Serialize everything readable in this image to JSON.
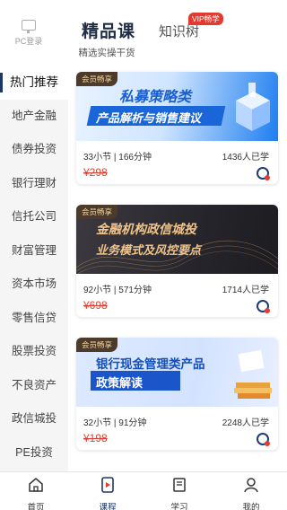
{
  "header": {
    "pc_login": "PC登录",
    "tab_main": {
      "title": "精品课",
      "subtitle": "精选实操干货"
    },
    "tab_knowledge": {
      "title": "知识树",
      "badge": "VIP畅学"
    }
  },
  "sidebar": {
    "items": [
      {
        "label": "热门推荐",
        "active": true
      },
      {
        "label": "地产金融"
      },
      {
        "label": "债券投资"
      },
      {
        "label": "银行理财"
      },
      {
        "label": "信托公司"
      },
      {
        "label": "财富管理"
      },
      {
        "label": "资本市场"
      },
      {
        "label": "零售信贷"
      },
      {
        "label": "股票投资"
      },
      {
        "label": "不良资产"
      },
      {
        "label": "政信城投"
      },
      {
        "label": "PE投资"
      }
    ]
  },
  "courses": [
    {
      "tag": "会员畅享",
      "title_line1": "私募策略类",
      "title_line2": "产品解析与销售建议",
      "meta": "33小节 | 166分钟",
      "learners": "1436人已学",
      "price": "¥298"
    },
    {
      "tag": "会员畅享",
      "title_line1": "金融机构政信城投",
      "title_line2": "业务模式及风控要点",
      "meta": "92小节 | 571分钟",
      "learners": "1714人已学",
      "price": "¥698"
    },
    {
      "tag": "会员畅享",
      "title_line1": "银行现金管理类产品",
      "title_line2": "政策解读",
      "meta": "32小节 | 91分钟",
      "learners": "2248人已学",
      "price": "¥198"
    }
  ],
  "tabbar": {
    "items": [
      {
        "label": "首页",
        "icon": "home-icon"
      },
      {
        "label": "课程",
        "icon": "course-icon",
        "active": true
      },
      {
        "label": "学习",
        "icon": "study-icon"
      },
      {
        "label": "我的",
        "icon": "profile-icon"
      }
    ]
  },
  "colors": {
    "accent": "#1f3766",
    "price": "#e53b2f",
    "vip_badge": "#e23a2f"
  }
}
